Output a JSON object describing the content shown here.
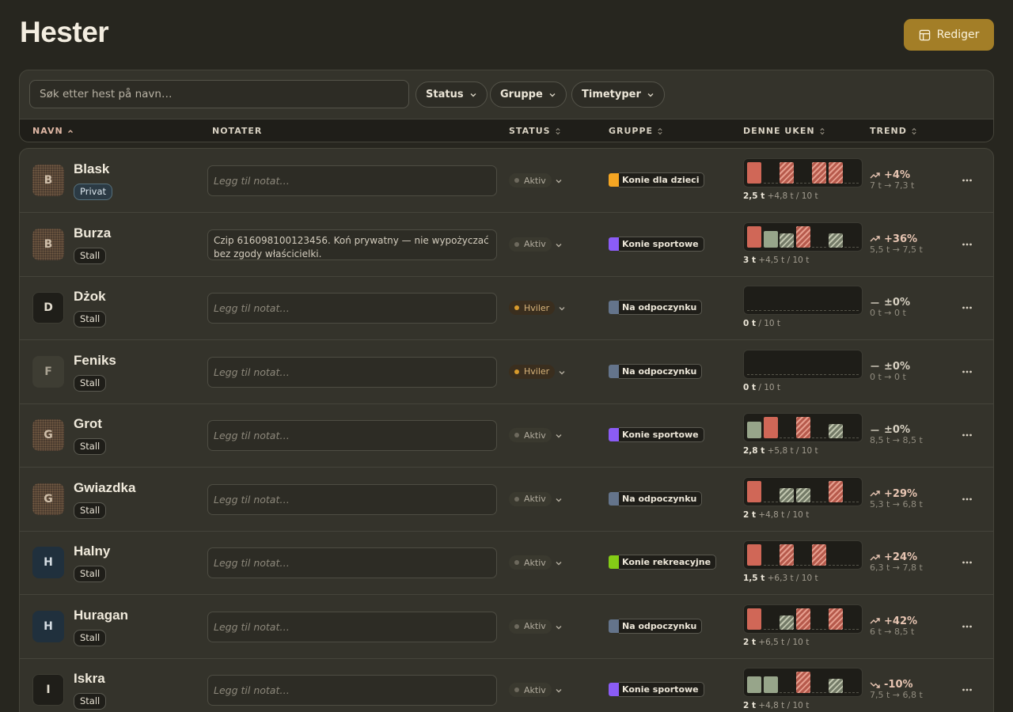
{
  "page": {
    "title": "Hester",
    "edit_label": "Rediger"
  },
  "toolbar": {
    "search_placeholder": "Søk etter hest på navn…",
    "filters": [
      "Status",
      "Gruppe",
      "Timetyper"
    ]
  },
  "columns": [
    "NAVN",
    "NOTATER",
    "STATUS",
    "GRUPPE",
    "DENNE UKEN",
    "TREND"
  ],
  "colors": {
    "background": "#27261f",
    "accent": "#a37e27",
    "bar_red": "#d06757",
    "bar_green": "#97a58a"
  },
  "note_placeholder": "Legg til notat…",
  "horses": [
    {
      "initial": "B",
      "avatar": "textured",
      "name": "Blask",
      "tag": "Privat",
      "private": true,
      "note": "",
      "status": "Aktiv",
      "group": "Konie dla dzieci",
      "group_color": "#f5a623",
      "week": [
        "red",
        "empty",
        "red-h",
        "empty",
        "red-h",
        "red-h",
        "empty"
      ],
      "hours": "2,5 t",
      "hours_rest": "+4,8 t / 10 t",
      "trend": "+4%",
      "trend_dir": "up",
      "trend_sub": "7 t → 7,3 t"
    },
    {
      "initial": "B",
      "avatar": "textured",
      "name": "Burza",
      "tag": "Stall",
      "private": false,
      "note": "Czip 616098100123456. Koń prywatny — nie wypożyczać bez zgody właścicielki.",
      "status": "Aktiv",
      "group": "Konie sportowe",
      "group_color": "#8b5cf6",
      "week": [
        "red",
        "green",
        "green-h",
        "red-h",
        "empty",
        "green-h",
        "empty"
      ],
      "hours": "3 t",
      "hours_rest": "+4,5 t / 10 t",
      "trend": "+36%",
      "trend_dir": "up",
      "trend_sub": "5,5 t → 7,5 t"
    },
    {
      "initial": "D",
      "avatar": "dark",
      "name": "Dżok",
      "tag": "Stall",
      "private": false,
      "note": "",
      "status": "Hviler",
      "group": "Na odpoczynku",
      "group_color": "#64748b",
      "week": [
        "empty",
        "empty",
        "empty",
        "empty",
        "empty",
        "empty",
        "empty"
      ],
      "hours": "0 t",
      "hours_rest": "/ 10 t",
      "trend": "±0%",
      "trend_dir": "flat",
      "trend_sub": "0 t → 0 t"
    },
    {
      "initial": "F",
      "avatar": "olive",
      "name": "Feniks",
      "tag": "Stall",
      "private": false,
      "note": "",
      "status": "Hviler",
      "group": "Na odpoczynku",
      "group_color": "#64748b",
      "week": [
        "empty",
        "empty",
        "empty",
        "empty",
        "empty",
        "empty",
        "empty"
      ],
      "hours": "0 t",
      "hours_rest": "/ 10 t",
      "trend": "±0%",
      "trend_dir": "flat",
      "trend_sub": "0 t → 0 t"
    },
    {
      "initial": "G",
      "avatar": "textured",
      "name": "Grot",
      "tag": "Stall",
      "private": false,
      "note": "",
      "status": "Aktiv",
      "group": "Konie sportowe",
      "group_color": "#8b5cf6",
      "week": [
        "green",
        "red",
        "empty",
        "red-h",
        "empty",
        "green-h",
        "empty"
      ],
      "hours": "2,8 t",
      "hours_rest": "+5,8 t / 10 t",
      "trend": "±0%",
      "trend_dir": "flat",
      "trend_sub": "8,5 t → 8,5 t"
    },
    {
      "initial": "G",
      "avatar": "textured",
      "name": "Gwiazdka",
      "tag": "Stall",
      "private": false,
      "note": "",
      "status": "Aktiv",
      "group": "Na odpoczynku",
      "group_color": "#64748b",
      "week": [
        "red",
        "empty",
        "green-h",
        "green-h",
        "empty",
        "red-h",
        "empty"
      ],
      "hours": "2 t",
      "hours_rest": "+4,8 t / 10 t",
      "trend": "+29%",
      "trend_dir": "up",
      "trend_sub": "5,3 t → 6,8 t"
    },
    {
      "initial": "H",
      "avatar": "navy",
      "name": "Halny",
      "tag": "Stall",
      "private": false,
      "note": "",
      "status": "Aktiv",
      "group": "Konie rekreacyjne",
      "group_color": "#84cc16",
      "week": [
        "red",
        "empty",
        "red-h",
        "empty",
        "red-h",
        "empty",
        "empty"
      ],
      "hours": "1,5 t",
      "hours_rest": "+6,3 t / 10 t",
      "trend": "+24%",
      "trend_dir": "up",
      "trend_sub": "6,3 t → 7,8 t"
    },
    {
      "initial": "H",
      "avatar": "navy",
      "name": "Huragan",
      "tag": "Stall",
      "private": false,
      "note": "",
      "status": "Aktiv",
      "group": "Na odpoczynku",
      "group_color": "#64748b",
      "week": [
        "red",
        "empty",
        "green-h",
        "red-h",
        "empty",
        "red-h",
        "empty"
      ],
      "hours": "2 t",
      "hours_rest": "+6,5 t / 10 t",
      "trend": "+42%",
      "trend_dir": "up",
      "trend_sub": "6 t → 8,5 t"
    },
    {
      "initial": "I",
      "avatar": "dark",
      "name": "Iskra",
      "tag": "Stall",
      "private": false,
      "note": "",
      "status": "Aktiv",
      "group": "Konie sportowe",
      "group_color": "#8b5cf6",
      "week": [
        "green",
        "green",
        "empty",
        "red-h",
        "empty",
        "green-h",
        "empty"
      ],
      "hours": "2 t",
      "hours_rest": "+4,8 t / 10 t",
      "trend": "-10%",
      "trend_dir": "down",
      "trend_sub": "7,5 t → 6,8 t"
    }
  ]
}
